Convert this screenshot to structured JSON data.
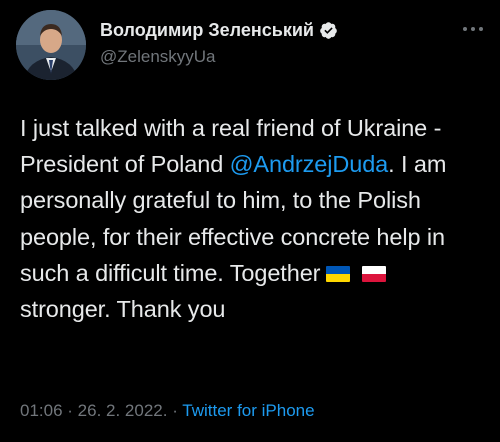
{
  "tweet": {
    "author": {
      "display_name": "Володимир Зеленський",
      "handle": "@ZelenskyyUa",
      "verified_icon": "verified-badge-icon"
    },
    "text": {
      "part1": "I just talked with a real friend of Ukraine - President of Poland ",
      "mention": "@AndrzejDuda",
      "part2": ". I am personally grateful to him, to the Polish people, for their effective concrete help in such a difficult time. Together",
      "part3": "stronger. Thank you"
    },
    "flags": [
      {
        "name": "ukraine-flag-icon",
        "top_color": "#0057b7",
        "bottom_color": "#ffd700"
      },
      {
        "name": "poland-flag-icon",
        "top_color": "#ffffff",
        "bottom_color": "#dc143c"
      }
    ],
    "meta": {
      "time": "01:06",
      "separator1": " · ",
      "date": "26. 2. 2022.",
      "separator2": " · ",
      "source": "Twitter for iPhone"
    }
  },
  "colors": {
    "background": "#000000",
    "text": "#e7e9ea",
    "secondary": "#71767b",
    "link": "#1d9bf0"
  }
}
